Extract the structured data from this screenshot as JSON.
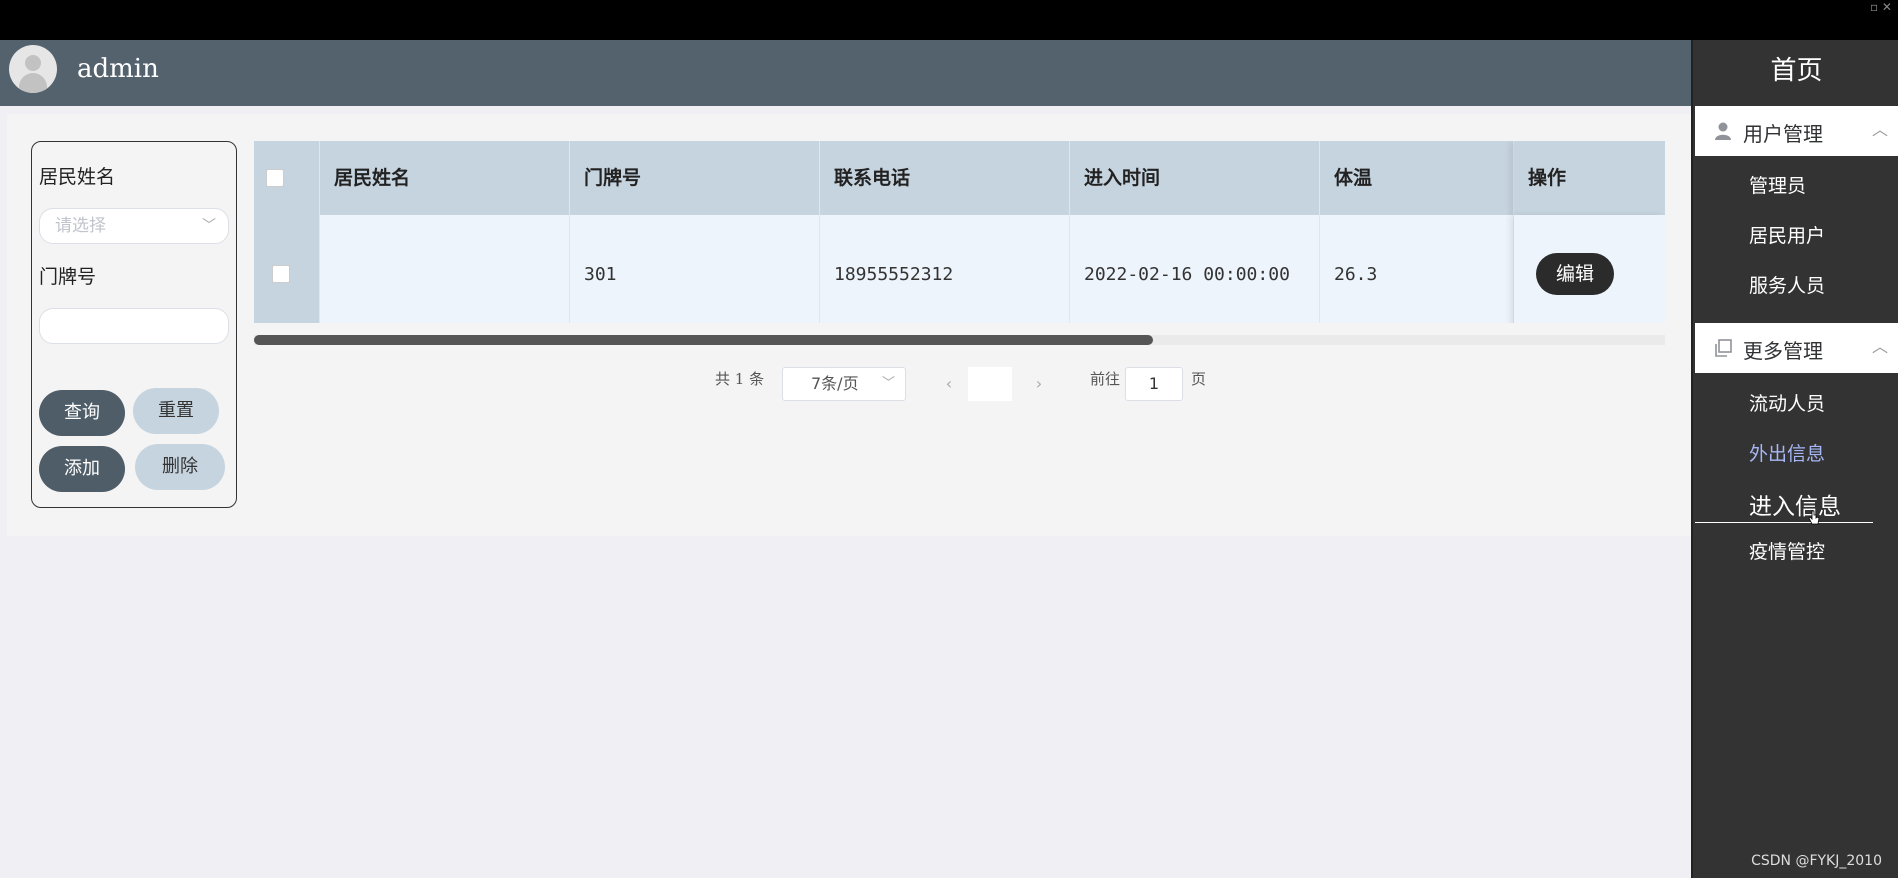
{
  "user": {
    "name": "admin"
  },
  "filter": {
    "resident_name_label": "居民姓名",
    "resident_name_placeholder": "请选择",
    "door_number_label": "门牌号",
    "door_number_value": "",
    "query_label": "查询",
    "reset_label": "重置",
    "add_label": "添加",
    "delete_label": "删除"
  },
  "table": {
    "columns": [
      "居民姓名",
      "门牌号",
      "联系电话",
      "进入时间",
      "体温",
      "操作"
    ],
    "rows": [
      {
        "resident_name": "",
        "door_number": "301",
        "phone": "18955552312",
        "entry_time": "2022-02-16 00:00:00",
        "temperature": "26.3",
        "action_label": "编辑"
      }
    ]
  },
  "pagination": {
    "total_text": "共 1 条",
    "page_size": "7条/页",
    "goto_label": "前往",
    "goto_value": "1",
    "page_suffix": "页"
  },
  "sidebar": {
    "home_label": "首页",
    "groups": [
      {
        "label": "用户管理",
        "icon": "user-icon",
        "items": [
          "管理员",
          "居民用户",
          "服务人员"
        ]
      },
      {
        "label": "更多管理",
        "icon": "copy-icon",
        "items": [
          "流动人员",
          "外出信息",
          "进入信息",
          "疫情管控"
        ]
      }
    ]
  },
  "watermark": "CSDN @FYKJ_2010",
  "colors": {
    "header": "#54626e",
    "sidebar": "#333333",
    "active_item": "#a7b7f5",
    "table_header": "#c6d4df"
  }
}
